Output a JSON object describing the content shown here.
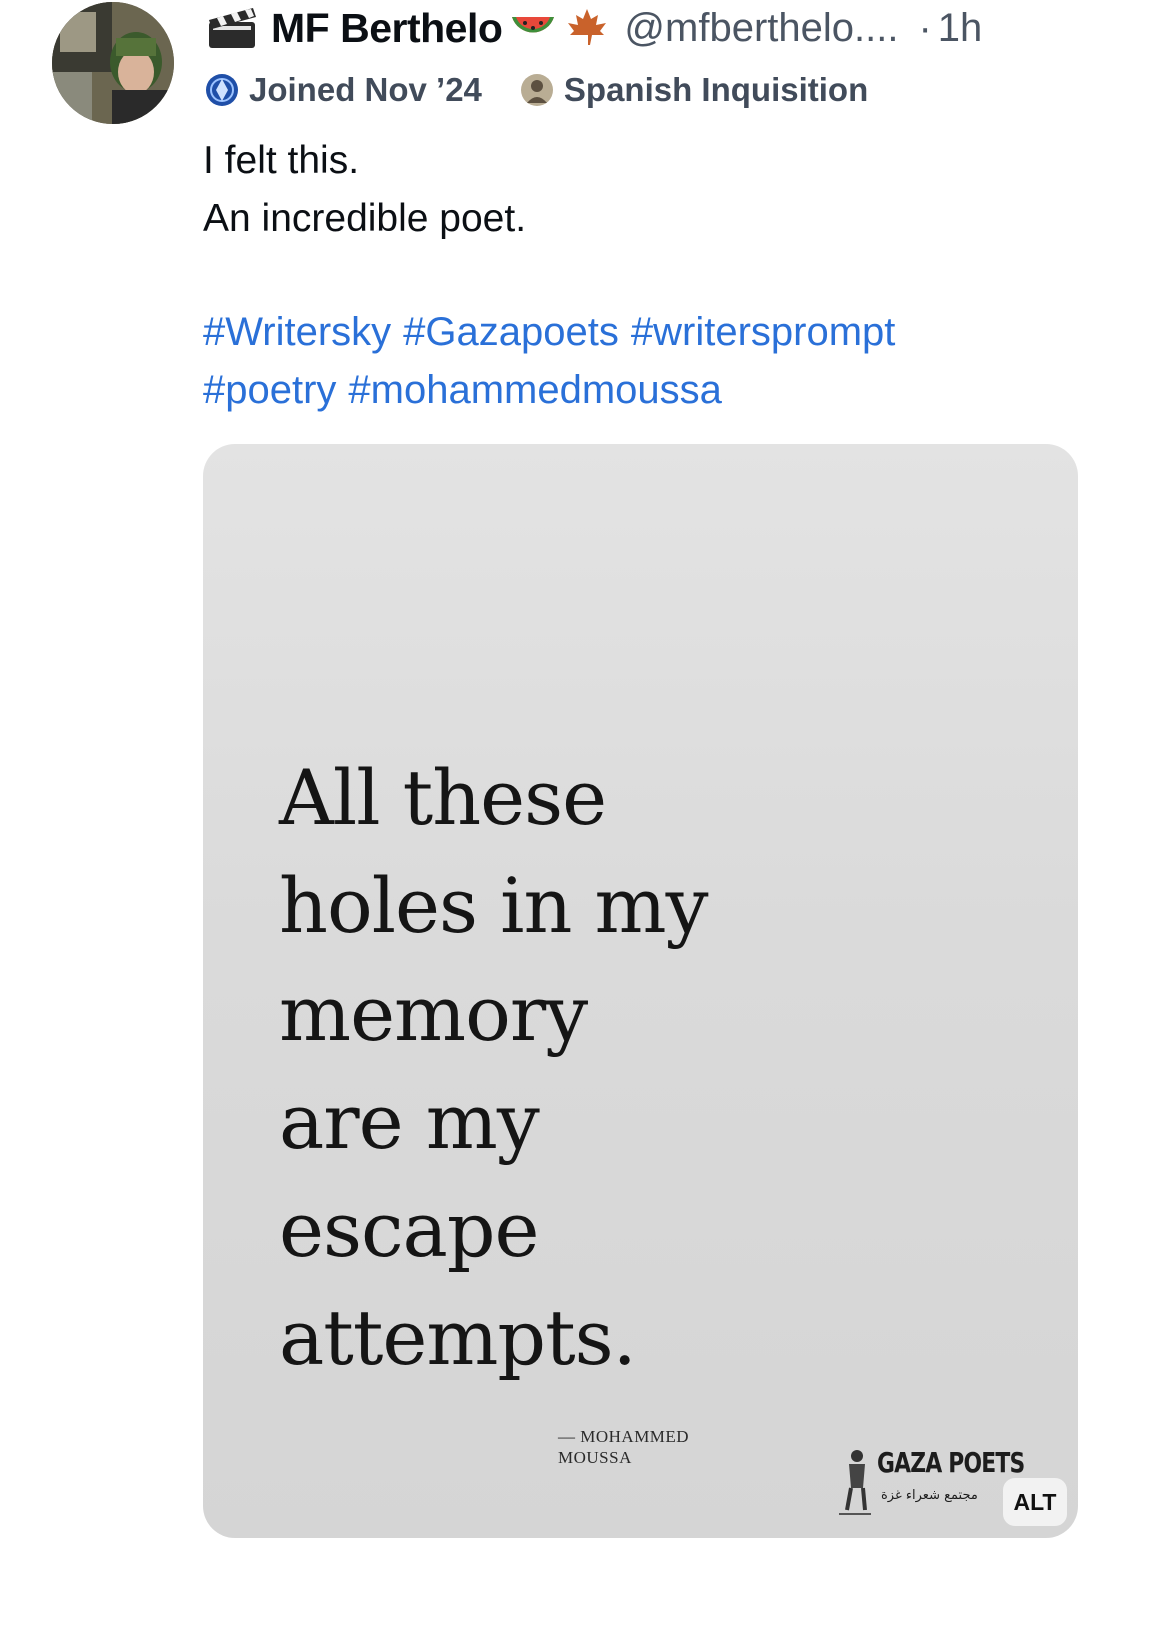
{
  "post": {
    "author": {
      "display_name": "MF Berthelo",
      "handle": "@mfberthelo....",
      "avatar_icon": "profile-photo",
      "name_icons": [
        "clapper-board-icon",
        "watermelon-icon",
        "maple-leaf-icon"
      ]
    },
    "separator": "·",
    "time": "1h",
    "meta": {
      "joined": "Joined Nov ’24",
      "joined_icon": "globe-badge-icon",
      "feed": "Spanish Inquisition",
      "feed_icon": "portrait-badge-icon"
    },
    "text_lines": [
      "I felt this.",
      "An incredible poet."
    ],
    "hashtags": [
      "#Writersky",
      "#Gazapoets",
      "#writersprompt",
      "#poetry",
      "#mohammedmoussa"
    ],
    "hashtag_color": "#2a70d8",
    "image": {
      "poem_lines": [
        "All these",
        "holes in my",
        "memory",
        "are my",
        "escape",
        "attempts."
      ],
      "author_lines": [
        "— MOHAMMED",
        "MOUSSA"
      ],
      "logo_title": "GAZA POETS",
      "logo_arabic": "مجتمع شعراء غزة",
      "alt_label": "ALT"
    }
  }
}
